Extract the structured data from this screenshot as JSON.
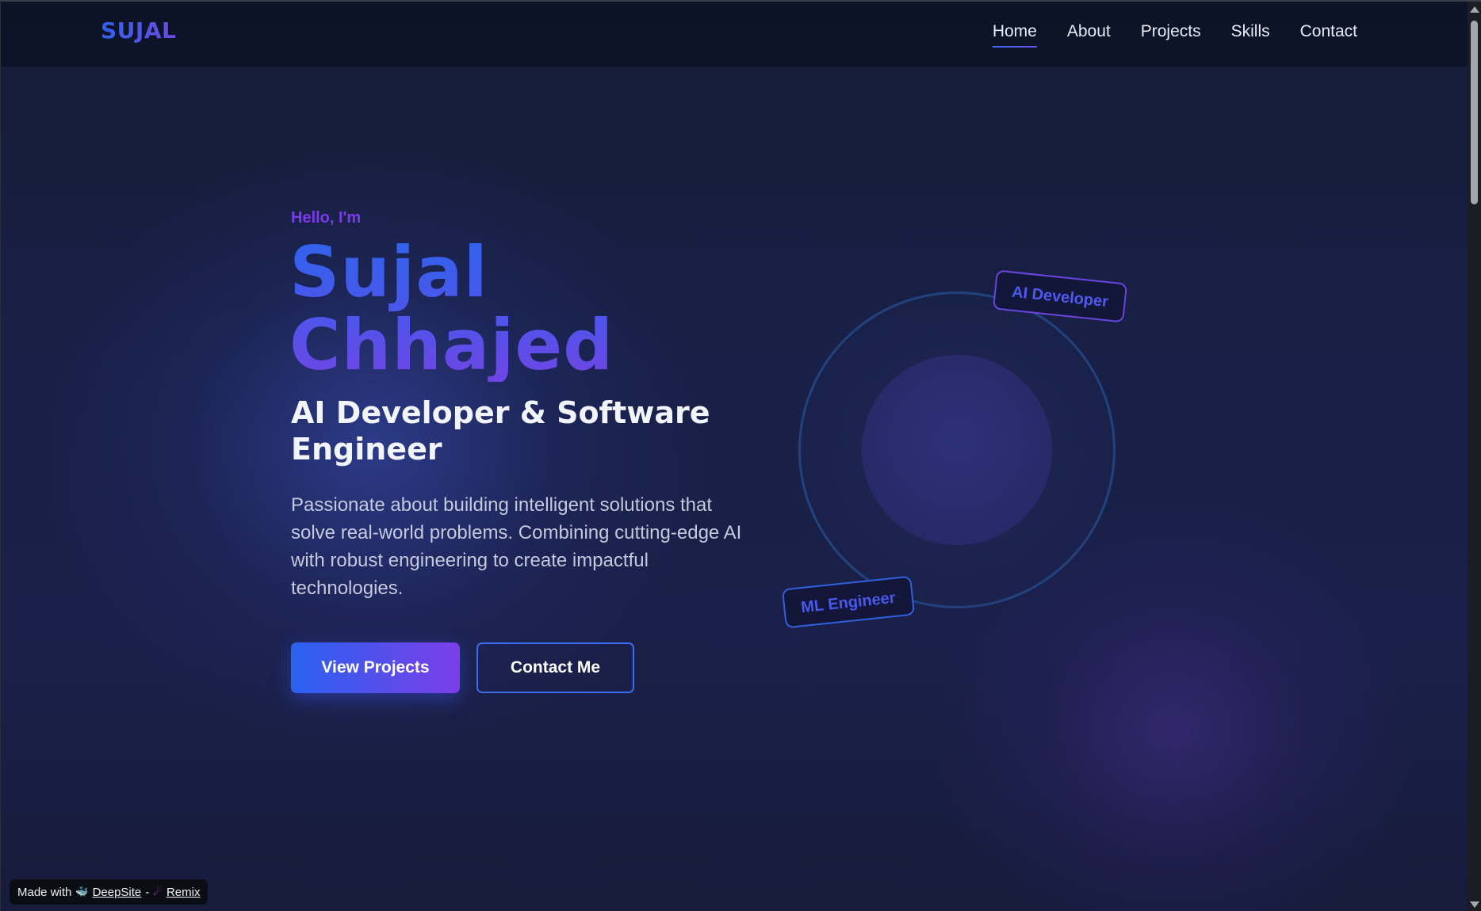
{
  "navbar": {
    "logo": "SUJAL",
    "links": [
      {
        "label": "Home",
        "active": true
      },
      {
        "label": "About",
        "active": false
      },
      {
        "label": "Projects",
        "active": false
      },
      {
        "label": "Skills",
        "active": false
      },
      {
        "label": "Contact",
        "active": false
      }
    ]
  },
  "hero": {
    "greeting": "Hello, I'm",
    "name_line1": "Sujal",
    "name_line2": "Chhajed",
    "role": "AI Developer & Software Engineer",
    "description": "Passionate about building intelligent solutions that solve real-world problems. Combining cutting-edge AI with robust engineering to create impactful technologies.",
    "primary_button": "View Projects",
    "secondary_button": "Contact Me"
  },
  "illustration": {
    "tag_top": "AI Developer",
    "tag_bottom": "ML Engineer"
  },
  "badge": {
    "made_with": "Made with",
    "deepsite": "DeepSite",
    "separator": "-",
    "remix": "Remix"
  },
  "colors": {
    "accent_blue": "#2f62ea",
    "accent_purple": "#7c3aed",
    "background": "#161d3a",
    "navbar": "#0d1226"
  }
}
